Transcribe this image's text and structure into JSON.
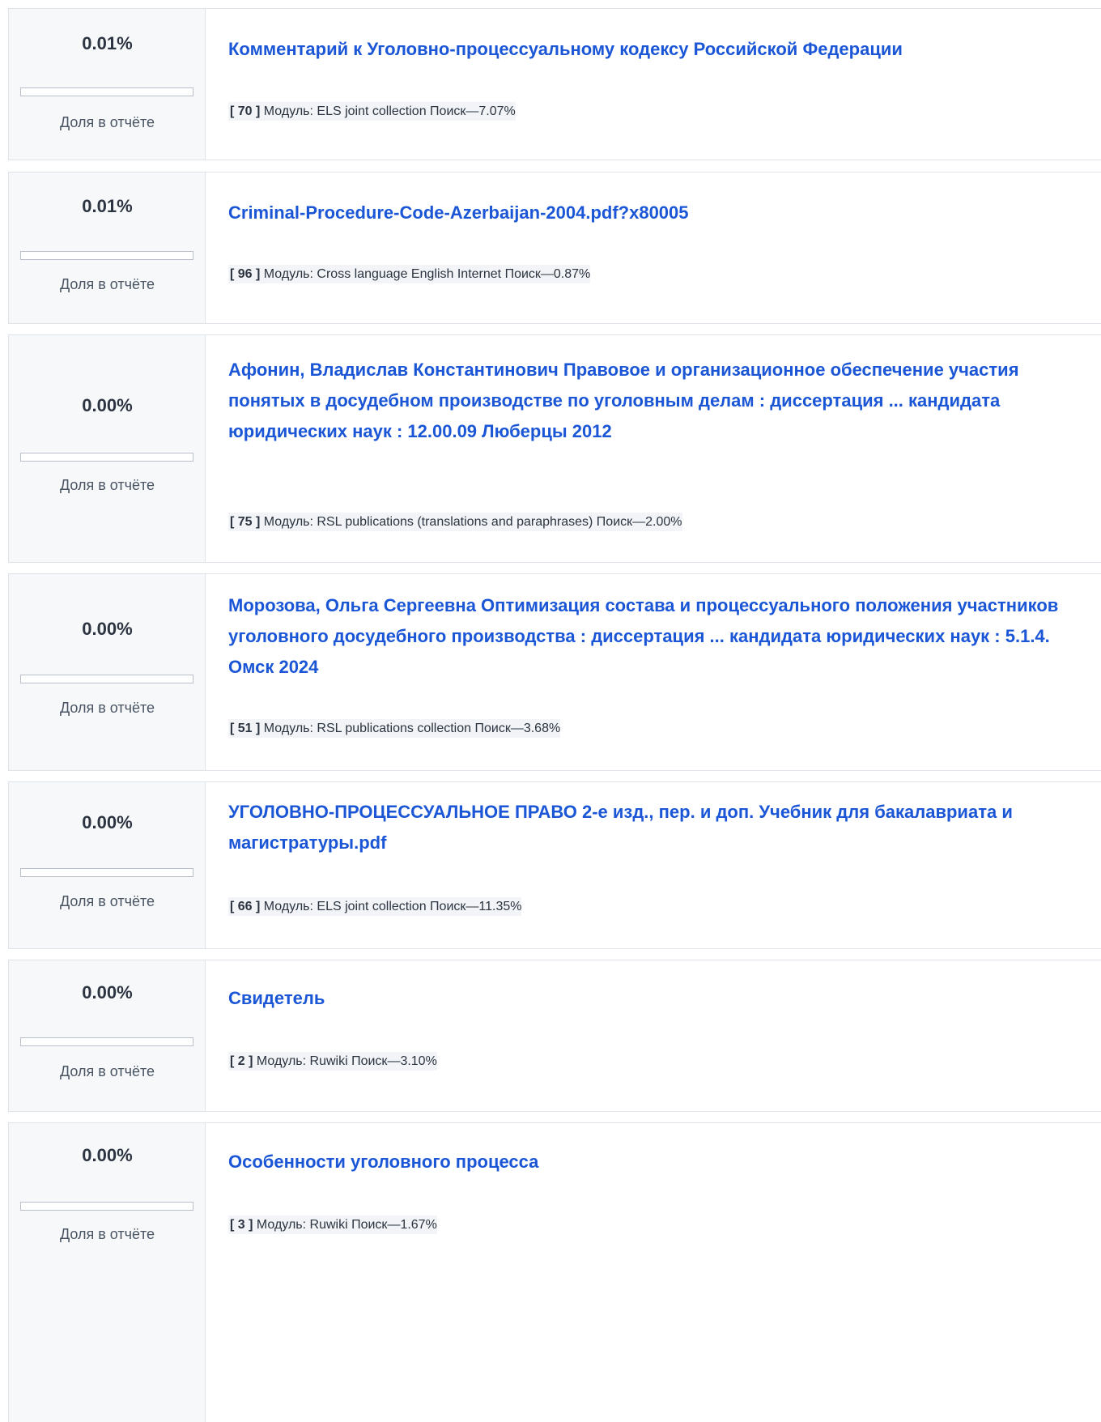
{
  "share_label": "Доля в отчёте",
  "module_prefix": "Модуль:",
  "search_word": "Поиск",
  "dash": "—",
  "accent_color": "#1a56d6",
  "sources": [
    {
      "share": "0.01%",
      "share_fraction": 0.0001,
      "title": "Комментарий к Уголовно-процессуальному кодексу Российской Федерации",
      "number": "[ 70 ]",
      "module": "ELS joint collection",
      "percent": "7.07%"
    },
    {
      "share": "0.01%",
      "share_fraction": 0.0001,
      "title": "Criminal-Procedure-Code-Azerbaijan-2004.pdf?x80005",
      "number": "[ 96 ]",
      "module": "Cross language English Internet",
      "percent": "0.87%"
    },
    {
      "share": "0.00%",
      "share_fraction": 0.0,
      "title": "Афонин, Владислав Константинович Правовое и организационное обеспечение участия понятых в досудебном производстве по уголовным делам : диссертация ... кандидата юридических наук : 12.00.09 Люберцы 2012",
      "number": "[ 75 ]",
      "module": "RSL publications (translations and paraphrases)",
      "percent": "2.00%"
    },
    {
      "share": "0.00%",
      "share_fraction": 0.0,
      "title": "Морозова, Ольга Сергеевна Оптимизация состава и процессуального положения участников уголовного досудебного производства : диссертация ... кандидата юридических наук : 5.1.4. Омск 2024",
      "number": "[ 51 ]",
      "module": "RSL publications collection",
      "percent": "3.68%"
    },
    {
      "share": "0.00%",
      "share_fraction": 0.0,
      "title": "УГОЛОВНО-ПРОЦЕССУАЛЬНОЕ ПРАВО 2-е изд., пер. и доп. Учебник для бакалавриата и магистратуры.pdf",
      "number": "[ 66 ]",
      "module": "ELS joint collection",
      "percent": "11.35%"
    },
    {
      "share": "0.00%",
      "share_fraction": 0.0,
      "title": "Свидетель",
      "number": "[ 2 ]",
      "module": "Ruwiki",
      "percent": "3.10%"
    },
    {
      "share": "0.00%",
      "share_fraction": 0.0,
      "title": "Особенности уголовного процесса",
      "number": "[ 3 ]",
      "module": "Ruwiki",
      "percent": "1.67%"
    }
  ]
}
